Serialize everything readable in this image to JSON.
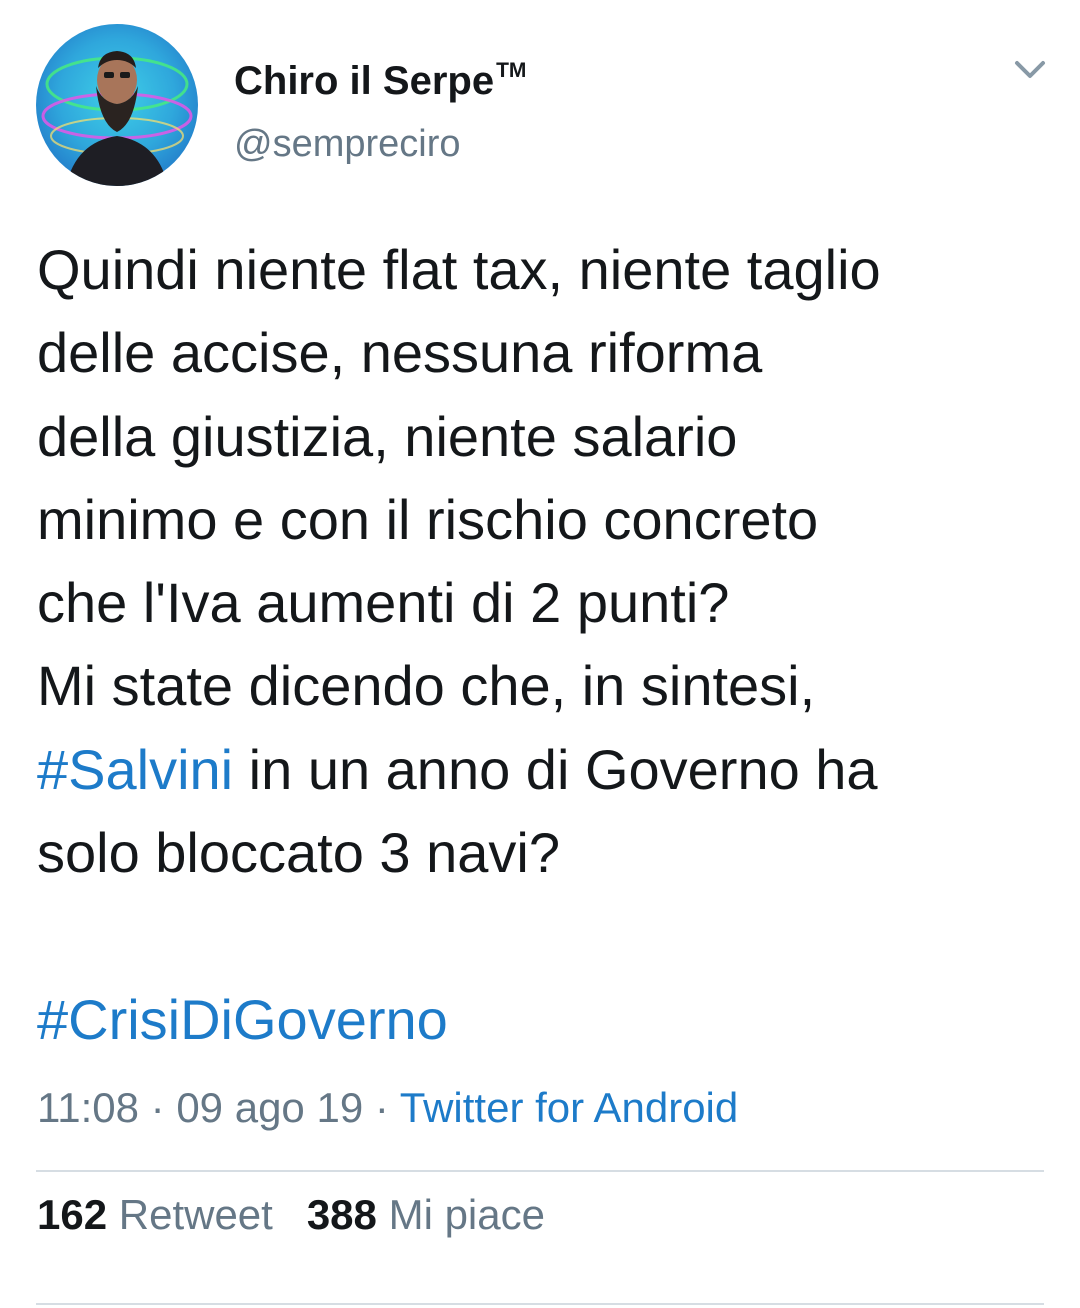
{
  "user": {
    "display_name": "Chiro il Serpe",
    "trademark": "TM",
    "handle": "@sempreciro",
    "avatar_icon": "profile-photo"
  },
  "tweet": {
    "lines": [
      "Quindi niente flat tax, niente taglio",
      "delle accise, nessuna riforma",
      "della giustizia, niente salario",
      "minimo e con il rischio concreto",
      "che l'Iva aumenti di 2 punti?",
      "Mi state dicendo che, in sintesi,"
    ],
    "hashtag_inline": "#Salvini",
    "after_hashtag": " in un anno di Governo ha",
    "last_line": "solo bloccato 3 navi?",
    "hashtag_tag": "#CrisiDiGoverno"
  },
  "meta": {
    "time": "11:08",
    "separator": " · ",
    "date": "09 ago 19",
    "source": "Twitter for Android"
  },
  "stats": {
    "retweet_count": "162",
    "retweet_label": "Retweet",
    "like_count": "388",
    "like_label": "Mi piace"
  },
  "colors": {
    "link": "#1d7bc9",
    "secondary": "#657786",
    "text": "#14171a",
    "divider": "#d6dde3"
  },
  "icons": {
    "menu": "chevron-down-icon"
  }
}
